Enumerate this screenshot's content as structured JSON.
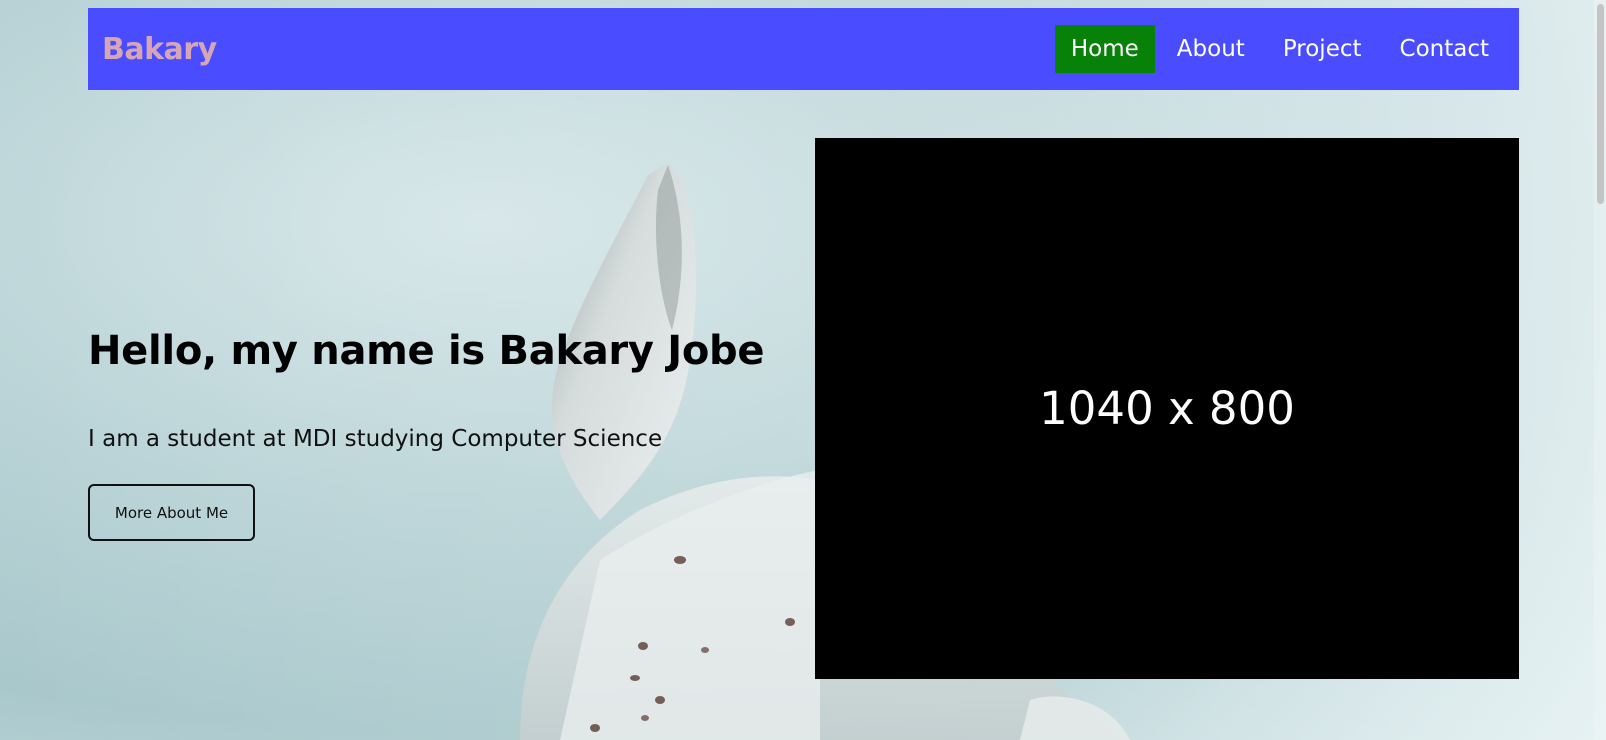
{
  "navbar": {
    "brand": "Bakary",
    "links": [
      {
        "label": "Home",
        "active": true
      },
      {
        "label": "About",
        "active": false
      },
      {
        "label": "Project",
        "active": false
      },
      {
        "label": "Contact",
        "active": false
      }
    ],
    "colors": {
      "background": "#4a4dff",
      "active": "#078107",
      "brand": "#d6a6b6"
    }
  },
  "hero": {
    "title": "Hello, my name is Bakary Jobe",
    "subtitle": "I am a student at MDI studying Computer Science",
    "button_label": "More About Me"
  },
  "image_placeholder": {
    "label": "1040 x 800"
  }
}
